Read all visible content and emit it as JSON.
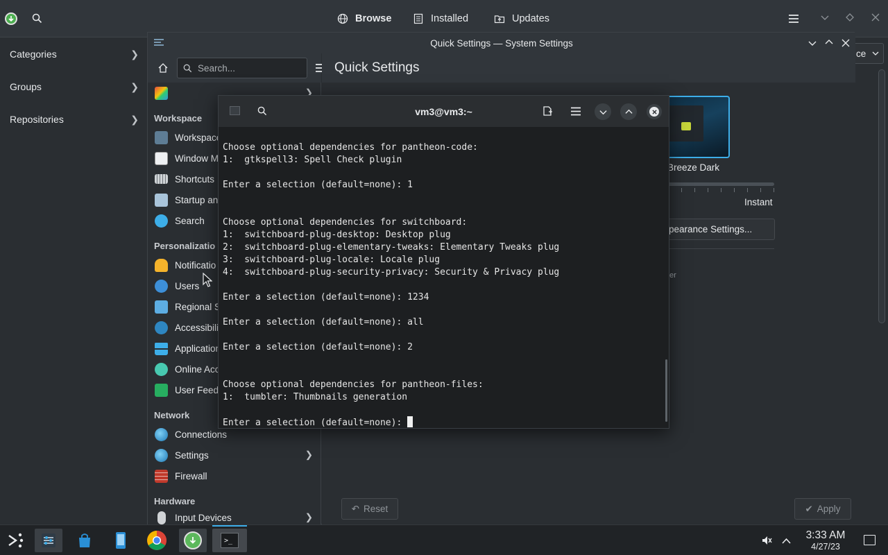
{
  "discover": {
    "tabs": [
      {
        "label": "Browse"
      },
      {
        "label": "Installed"
      },
      {
        "label": "Updates"
      }
    ],
    "sidebar": [
      {
        "label": "Categories"
      },
      {
        "label": "Groups"
      },
      {
        "label": "Repositories"
      }
    ],
    "partial_dropdown": "ce"
  },
  "settings": {
    "title": "Quick Settings — System Settings",
    "search_placeholder": "Search...",
    "page_title": "Quick Settings",
    "sections": {
      "workspace": "Workspace",
      "personalization": "Personalizatio",
      "network": "Network",
      "hardware": "Hardware"
    },
    "items": {
      "workspace": "Workspace",
      "window_management": "Window M",
      "shortcuts": "Shortcuts",
      "startup": "Startup an",
      "search": "Search",
      "notifications": "Notificatio",
      "users": "Users",
      "regional": "Regional S",
      "accessibility": "Accessibili",
      "applications": "Application",
      "online_accounts": "Online Acc",
      "user_feedback": "User Feedb",
      "connections": "Connections",
      "net_settings": "Settings",
      "firewall": "Firewall",
      "input_devices": "Input Devices"
    },
    "theme_label": "Breeze Dark",
    "animation_label": "Instant",
    "appearance_button": "e Appearance Settings...",
    "partial_text": "er",
    "reset_button": "Reset",
    "apply_button": "Apply"
  },
  "konsole": {
    "title": "vm3@vm3:~",
    "lines": [
      "Choose optional dependencies for pantheon-code:",
      "1:  gtkspell3: Spell Check plugin",
      "",
      "Enter a selection (default=none): 1",
      "",
      "",
      "Choose optional dependencies for switchboard:",
      "1:  switchboard-plug-desktop: Desktop plug",
      "2:  switchboard-plug-elementary-tweaks: Elementary Tweaks plug",
      "3:  switchboard-plug-locale: Locale plug",
      "4:  switchboard-plug-security-privacy: Security & Privacy plug",
      "",
      "Enter a selection (default=none): 1234",
      "",
      "Enter a selection (default=none): all",
      "",
      "Enter a selection (default=none): 2",
      "",
      "",
      "Choose optional dependencies for pantheon-files:",
      "1:  tumbler: Thumbnails generation",
      ""
    ],
    "prompt": "Enter a selection (default=none): "
  },
  "taskbar": {
    "time": "3:33 AM",
    "date": "4/27/23"
  },
  "colors": {
    "accent": "#3daee9",
    "terminal_bg": "#1d1f21",
    "panel_bg": "#202326"
  }
}
